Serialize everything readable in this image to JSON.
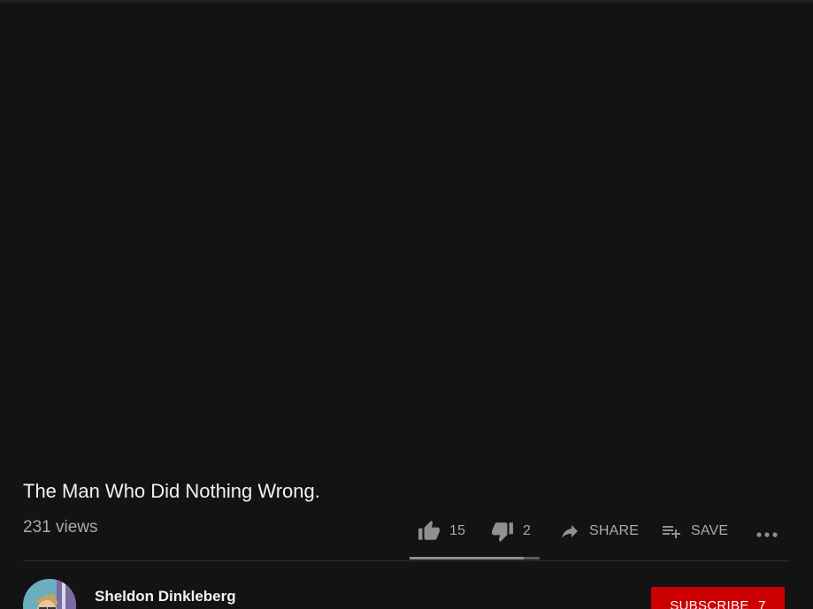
{
  "video": {
    "title": "The Man Who Did Nothing Wrong.",
    "views": "231 views"
  },
  "actions": {
    "like_count": "15",
    "dislike_count": "2",
    "share_label": "SHARE",
    "save_label": "SAVE",
    "like_ratio": 0.88
  },
  "channel": {
    "name": "Sheldon Dinkleberg",
    "subscribe_label": "SUBSCRIBE",
    "subscriber_count": "7"
  },
  "icons": {
    "like": "thumb-up-icon",
    "dislike": "thumb-down-icon",
    "share": "share-arrow-icon",
    "save": "playlist-add-icon",
    "more": "more-horizontal-icon"
  },
  "colors": {
    "background": "#131313",
    "subscribe": "#cc0000",
    "text_primary": "#f1f1f1",
    "text_secondary": "#aaaaaa"
  }
}
